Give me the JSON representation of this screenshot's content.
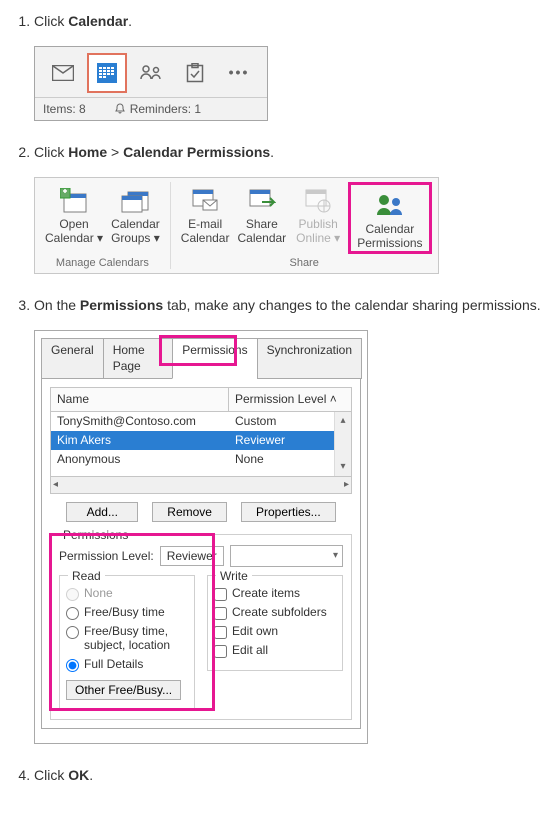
{
  "step1": {
    "text_prefix": "Click ",
    "bold": "Calendar",
    "text_suffix": ".",
    "items_label": "Items: 8",
    "reminders_label": "Reminders: 1"
  },
  "step2": {
    "text_prefix": "Click ",
    "bold1": "Home",
    "sep": " > ",
    "bold2": "Calendar Permissions",
    "text_suffix": ".",
    "ribbon": {
      "manage_label": "Manage Calendars",
      "share_label": "Share",
      "open_l1": "Open",
      "open_l2": "Calendar ▾",
      "groups_l1": "Calendar",
      "groups_l2": "Groups ▾",
      "email_l1": "E-mail",
      "email_l2": "Calendar",
      "sharecal_l1": "Share",
      "sharecal_l2": "Calendar",
      "publish_l1": "Publish",
      "publish_l2": "Online ▾",
      "perm_l1": "Calendar",
      "perm_l2": "Permissions"
    }
  },
  "step3": {
    "text_prefix": "On the ",
    "bold": "Permissions",
    "text_suffix": " tab, make any changes to the calendar sharing permissions.",
    "tabs": [
      "General",
      "Home Page",
      "Permissions",
      "Synchronization"
    ],
    "columns": {
      "name": "Name",
      "level": "Permission Level"
    },
    "rows": [
      {
        "name": "TonySmith@Contoso.com",
        "level": "Custom"
      },
      {
        "name": "Kim Akers",
        "level": "Reviewer"
      },
      {
        "name": "Anonymous",
        "level": "None"
      }
    ],
    "buttons": {
      "add": "Add...",
      "remove": "Remove",
      "properties": "Properties..."
    },
    "permissions_legend": "Permissions",
    "level_label": "Permission Level:",
    "level_value": "Reviewer",
    "read_legend": "Read",
    "write_legend": "Write",
    "read_options": {
      "none": "None",
      "fb": "Free/Busy time",
      "fbsl": "Free/Busy time, subject, location",
      "full": "Full Details"
    },
    "write_options": {
      "create_items": "Create items",
      "create_sub": "Create subfolders",
      "edit_own": "Edit own",
      "edit_all": "Edit all"
    },
    "other_btn": "Other Free/Busy..."
  },
  "step4": {
    "text_prefix": "Click ",
    "bold": "OK",
    "text_suffix": "."
  }
}
